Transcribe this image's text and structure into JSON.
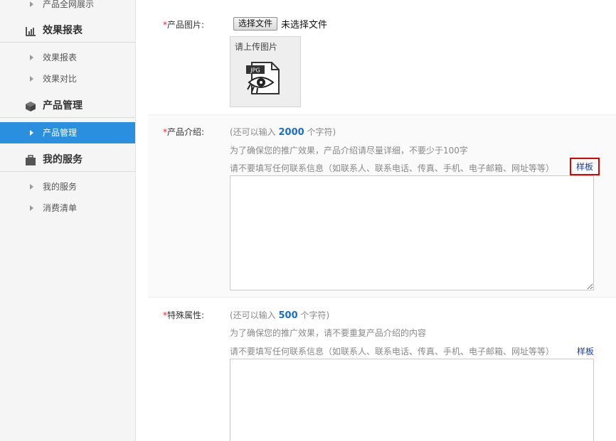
{
  "sidebar": {
    "top_item": "产品全网展示",
    "sections": [
      {
        "title": "效果报表",
        "icon": "bar-chart-icon",
        "items": [
          "效果报表",
          "效果对比"
        ]
      },
      {
        "title": "产品管理",
        "icon": "cube-icon",
        "items": [
          "产品管理"
        ]
      },
      {
        "title": "我的服务",
        "icon": "briefcase-icon",
        "items": [
          "我的服务",
          "消费清单"
        ]
      }
    ],
    "active_item": "产品管理",
    "active_color": "#2b8fe0"
  },
  "form": {
    "image": {
      "required_mark": "*",
      "label": "产品图片:",
      "choose_button": "选择文件",
      "file_status": "未选择文件",
      "upload_placeholder": "请上传图片",
      "file_type_badge": "JPG"
    },
    "intro": {
      "required_mark": "*",
      "label": "产品介绍:",
      "remaining_prefix": "(还可以输入",
      "remaining_count": "2000",
      "remaining_suffix": "个字符)",
      "hint1": "为了确保您的推广效果，产品介绍请尽量详细，不要少于100字",
      "hint2": "请不要填写任何联系信息（如联系人、联系电话、传真、手机、电子邮箱、网址等等）",
      "sample_link": "样板",
      "value": ""
    },
    "special": {
      "required_mark": "*",
      "label": "特殊属性:",
      "remaining_prefix": "(还可以输入",
      "remaining_count": "500",
      "remaining_suffix": "个字符)",
      "hint1": "为了确保您的推广效果，请不要重复产品介绍的内容",
      "hint2": "请不要填写任何联系信息（如联系人、联系电话、传真、手机、电子邮箱、网址等等）",
      "sample_link": "样板",
      "value": ""
    }
  }
}
